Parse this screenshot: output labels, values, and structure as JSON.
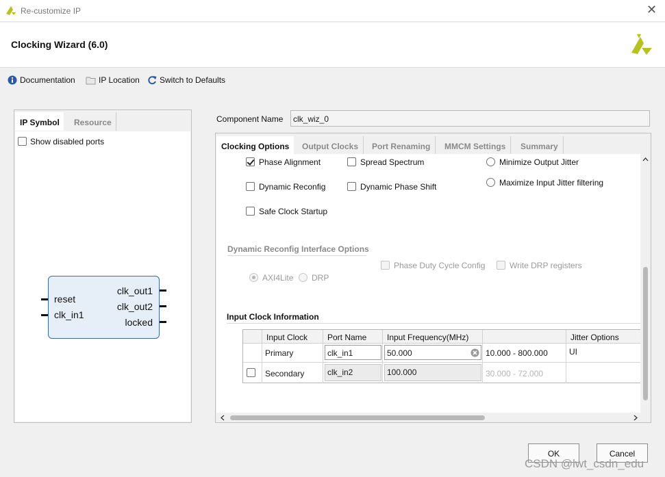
{
  "window": {
    "title": "Re-customize IP",
    "close_glyph": "✕"
  },
  "header": {
    "title": "Clocking Wizard (6.0)"
  },
  "toolbar": {
    "documentation": "Documentation",
    "ip_location": "IP Location",
    "switch_defaults": "Switch to Defaults"
  },
  "left": {
    "tabs": [
      "IP Symbol",
      "Resource"
    ],
    "show_disabled": "Show disabled ports",
    "symbol": {
      "inputs": [
        "reset",
        "clk_in1"
      ],
      "outputs": [
        "clk_out1",
        "clk_out2",
        "locked"
      ]
    }
  },
  "component": {
    "label": "Component Name",
    "value": "clk_wiz_0"
  },
  "tabs": [
    "Clocking Options",
    "Output Clocks",
    "Port Renaming",
    "MMCM Settings",
    "Summary"
  ],
  "options": {
    "phase_alignment": "Phase Alignment",
    "spread_spectrum": "Spread Spectrum",
    "min_output_jitter": "Minimize Output Jitter",
    "dynamic_reconfig": "Dynamic Reconfig",
    "dynamic_phase_shift": "Dynamic Phase Shift",
    "max_input_jitter": "Maximize Input Jitter filtering",
    "safe_clock_startup": "Safe Clock Startup"
  },
  "drp": {
    "title": "Dynamic Reconfig Interface Options",
    "phase_duty": "Phase Duty Cycle Config",
    "write_drp": "Write DRP registers",
    "axi4lite": "AXI4Lite",
    "drp": "DRP"
  },
  "input_clock": {
    "title": "Input Clock Information",
    "headers": [
      "Input Clock",
      "Port Name",
      "Input Frequency(MHz)",
      "",
      "Jitter Options"
    ],
    "primary": {
      "name": "Primary",
      "port": "clk_in1",
      "freq": "50.000",
      "range": "10.000 - 800.000",
      "jitter": "UI"
    },
    "secondary": {
      "name": "Secondary",
      "port": "clk_in2",
      "freq": "100.000",
      "range": "30.000 - 72.000"
    }
  },
  "buttons": {
    "ok": "OK",
    "cancel": "Cancel"
  },
  "watermark": "CSDN @lwt_csdn_edu",
  "colors": {
    "accent": "#3a67b6",
    "logo": "#b6c21e",
    "block_fill": "#e6eef8"
  }
}
